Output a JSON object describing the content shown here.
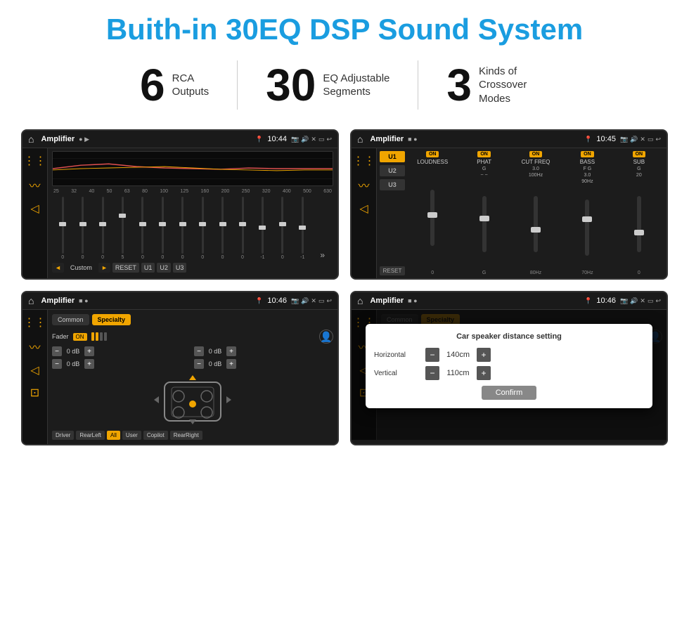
{
  "header": {
    "title": "Buith-in 30EQ DSP Sound System"
  },
  "stats": [
    {
      "number": "6",
      "label": "RCA\nOutputs"
    },
    {
      "number": "30",
      "label": "EQ Adjustable\nSegments"
    },
    {
      "number": "3",
      "label": "Kinds of\nCrossover Modes"
    }
  ],
  "screens": [
    {
      "id": "screen1",
      "status": {
        "title": "Amplifier",
        "time": "10:44"
      },
      "type": "eq"
    },
    {
      "id": "screen2",
      "status": {
        "title": "Amplifier",
        "time": "10:45"
      },
      "type": "crossover"
    },
    {
      "id": "screen3",
      "status": {
        "title": "Amplifier",
        "time": "10:46"
      },
      "type": "fader"
    },
    {
      "id": "screen4",
      "status": {
        "title": "Amplifier",
        "time": "10:46"
      },
      "type": "fader-dialog",
      "dialog": {
        "title": "Car speaker distance setting",
        "horizontal_label": "Horizontal",
        "horizontal_value": "140cm",
        "vertical_label": "Vertical",
        "vertical_value": "110cm",
        "confirm_label": "Confirm"
      }
    }
  ],
  "eq": {
    "freqs": [
      "25",
      "32",
      "40",
      "50",
      "63",
      "80",
      "100",
      "125",
      "160",
      "200",
      "250",
      "320",
      "400",
      "500",
      "630"
    ],
    "values": [
      "0",
      "0",
      "0",
      "5",
      "0",
      "0",
      "0",
      "0",
      "0",
      "0",
      "-1",
      "0",
      "-1"
    ],
    "buttons": [
      "◄",
      "Custom",
      "►",
      "RESET",
      "U1",
      "U2",
      "U3"
    ]
  },
  "crossover": {
    "channels": [
      "U1",
      "U2",
      "U3"
    ],
    "labels": [
      "LOUDNESS",
      "PHAT",
      "CUT FREQ",
      "BASS",
      "SUB"
    ],
    "reset": "RESET"
  },
  "fader": {
    "tabs": [
      "Common",
      "Specialty"
    ],
    "fader_label": "Fader",
    "on_label": "ON",
    "db_values": [
      "0 dB",
      "0 dB",
      "0 dB",
      "0 dB"
    ],
    "bottom_btns": [
      "Driver",
      "RearLeft",
      "All",
      "User",
      "Copilot",
      "RearRight"
    ]
  },
  "dialog": {
    "title": "Car speaker distance setting",
    "horizontal": "140cm",
    "vertical": "110cm",
    "confirm": "Confirm"
  }
}
